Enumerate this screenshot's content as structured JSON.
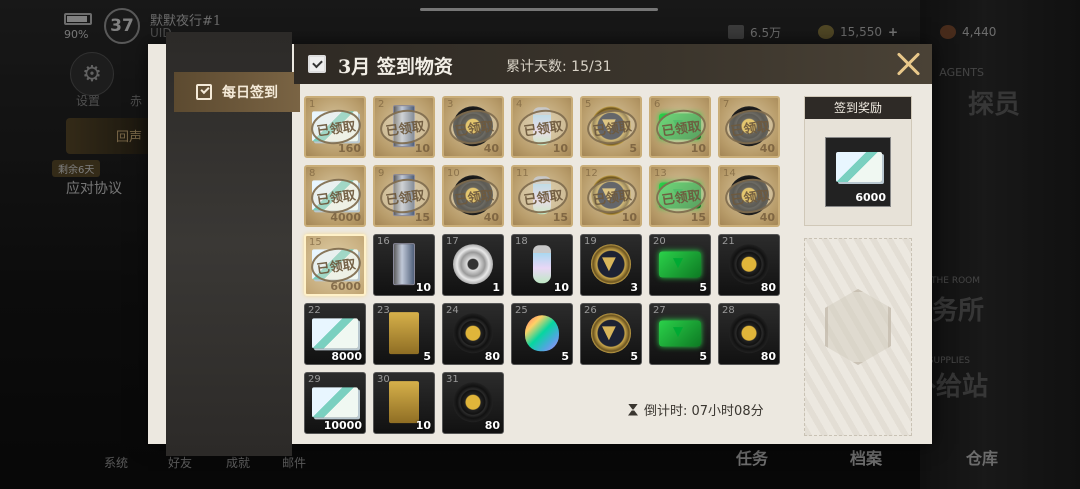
{
  "hud": {
    "battery": "90%",
    "level": "37",
    "player_name": "默默夜行#1",
    "uid": "UID",
    "resources": [
      {
        "icon": "cash-icon",
        "value": "6.5万"
      },
      {
        "icon": "coin-icon",
        "value": "15,550"
      },
      {
        "icon": "gem-icon",
        "value": "4,440"
      }
    ],
    "plus": "+"
  },
  "side_menu": {
    "settings_label": "设置",
    "other_label": "赤",
    "promo_label": "回声",
    "promo_tag": "剩余6天",
    "promo2_label": "应对协议"
  },
  "bg_signs": [
    "探员",
    "事务所",
    "补给站"
  ],
  "bg_small": [
    "AGENTS",
    "THE ROOM",
    "SUPPLIES"
  ],
  "bottom_nav": {
    "items": [
      "系统",
      "好友",
      "成就",
      "邮件"
    ],
    "right_items": [
      "任务",
      "档案",
      "仓库"
    ]
  },
  "modal": {
    "title": "3月 签到物资",
    "days_label": "累计天数: 15/31",
    "tab_label": "每日签到",
    "claimed_text": "已领取",
    "reward_title": "签到奖励",
    "reward_qty": "6000",
    "countdown": "倒计时: 07小时08分"
  },
  "days": [
    {
      "n": "1",
      "qty": "160",
      "state": "claimed",
      "item": "cash-icon"
    },
    {
      "n": "2",
      "qty": "10",
      "state": "claimed",
      "item": "tape-icon"
    },
    {
      "n": "3",
      "qty": "40",
      "state": "claimed",
      "item": "vinyl-icon"
    },
    {
      "n": "4",
      "qty": "10",
      "state": "claimed",
      "item": "bottle-icon"
    },
    {
      "n": "5",
      "qty": "5",
      "state": "claimed",
      "item": "badge-icon"
    },
    {
      "n": "6",
      "qty": "10",
      "state": "claimed",
      "item": "card-icon"
    },
    {
      "n": "7",
      "qty": "40",
      "state": "claimed",
      "item": "vinyl-icon"
    },
    {
      "n": "8",
      "qty": "4000",
      "state": "claimed",
      "item": "cash-icon"
    },
    {
      "n": "9",
      "qty": "15",
      "state": "claimed",
      "item": "tape-icon"
    },
    {
      "n": "10",
      "qty": "40",
      "state": "claimed",
      "item": "vinyl-icon"
    },
    {
      "n": "11",
      "qty": "15",
      "state": "claimed",
      "item": "bottle-icon"
    },
    {
      "n": "12",
      "qty": "10",
      "state": "claimed",
      "item": "badge-icon"
    },
    {
      "n": "13",
      "qty": "15",
      "state": "claimed",
      "item": "card-icon"
    },
    {
      "n": "14",
      "qty": "40",
      "state": "claimed",
      "item": "vinyl-icon"
    },
    {
      "n": "15",
      "qty": "6000",
      "state": "today",
      "item": "cash-icon"
    },
    {
      "n": "16",
      "qty": "10",
      "state": "pending",
      "item": "tape-icon"
    },
    {
      "n": "17",
      "qty": "1",
      "state": "pending",
      "item": "cd-icon"
    },
    {
      "n": "18",
      "qty": "10",
      "state": "pending",
      "item": "bottle-icon"
    },
    {
      "n": "19",
      "qty": "3",
      "state": "pending",
      "item": "badge-icon"
    },
    {
      "n": "20",
      "qty": "5",
      "state": "pending",
      "item": "card-icon"
    },
    {
      "n": "21",
      "qty": "80",
      "state": "pending",
      "item": "vinyl-icon"
    },
    {
      "n": "22",
      "qty": "8000",
      "state": "pending",
      "item": "cash-icon"
    },
    {
      "n": "23",
      "qty": "5",
      "state": "pending",
      "item": "cassette-icon"
    },
    {
      "n": "24",
      "qty": "80",
      "state": "pending",
      "item": "vinyl-icon"
    },
    {
      "n": "25",
      "qty": "5",
      "state": "pending",
      "item": "potion-icon"
    },
    {
      "n": "26",
      "qty": "5",
      "state": "pending",
      "item": "badge-icon"
    },
    {
      "n": "27",
      "qty": "5",
      "state": "pending",
      "item": "card-icon"
    },
    {
      "n": "28",
      "qty": "80",
      "state": "pending",
      "item": "vinyl-icon"
    },
    {
      "n": "29",
      "qty": "10000",
      "state": "pending",
      "item": "cash-icon"
    },
    {
      "n": "30",
      "qty": "10",
      "state": "pending",
      "item": "cassette-icon"
    },
    {
      "n": "31",
      "qty": "80",
      "state": "pending",
      "item": "vinyl-icon"
    }
  ]
}
